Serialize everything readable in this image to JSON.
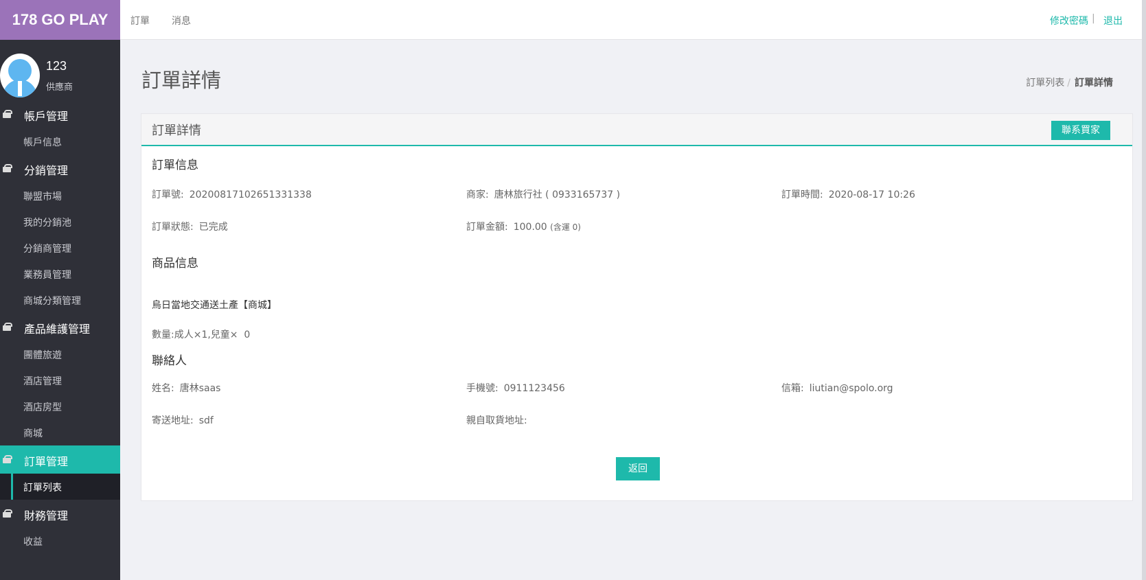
{
  "brand": "178 GO PLAY",
  "topnav": [
    "訂單",
    "消息"
  ],
  "top_actions": {
    "change_password": "修改密碼",
    "separator": "|",
    "logout": "退出"
  },
  "profile": {
    "name": "123",
    "role": "供應商"
  },
  "sidebar": {
    "sections": [
      {
        "label": "帳戶管理",
        "items": [
          "帳戶信息"
        ]
      },
      {
        "label": "分銷管理",
        "items": [
          "聯盟市場",
          "我的分銷池",
          "分銷商管理",
          "業務員管理",
          "商城分類管理"
        ]
      },
      {
        "label": "產品維護管理",
        "items": [
          "團體旅遊",
          "酒店管理",
          "酒店房型",
          "商城"
        ]
      },
      {
        "label": "訂單管理",
        "items": [
          "訂單列表"
        ]
      },
      {
        "label": "財務管理",
        "items": [
          "收益"
        ]
      }
    ]
  },
  "page": {
    "title": "訂單詳情"
  },
  "breadcrumb": {
    "parent": "訂單列表",
    "sep": "/",
    "current": "訂單詳情"
  },
  "card": {
    "title": "訂單詳情",
    "contact_button": "聯系買家",
    "order_section": "訂單信息",
    "order": {
      "number_label": "訂單號:",
      "number": "20200817102651331338",
      "merchant_label": "商家:",
      "merchant": "唐林旅行社 ( 0933165737 )",
      "time_label": "訂單時間:",
      "time": "2020-08-17 10:26",
      "status_label": "訂單狀態:",
      "status": "已完成",
      "amount_label": "訂單金額:",
      "amount": "100.00",
      "shipping": "(含運 0)"
    },
    "product_section": "商品信息",
    "product": {
      "name": "烏日當地交通送土產【商城】",
      "qty_label": "數量:",
      "qty": "成人×1,兒童×  0"
    },
    "contact_section": "聯絡人",
    "contact": {
      "name_label": "姓名:",
      "name": "唐林saas",
      "phone_label": "手機號:",
      "phone": "0911123456",
      "email_label": "信箱:",
      "email": "liutian@spolo.org",
      "address_label": "寄送地址:",
      "address": "sdf",
      "pickup_label": "親自取貨地址:",
      "pickup": ""
    },
    "back_button": "返回"
  },
  "colors": {
    "brand": "#9b73b9",
    "accent": "#1eb9ab",
    "sidebar": "#2f3038"
  },
  "icons": {
    "section": "gift-icon"
  }
}
